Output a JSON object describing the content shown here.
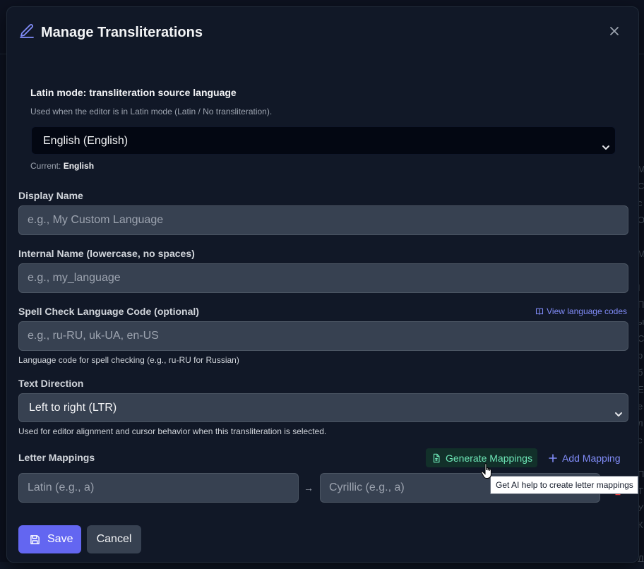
{
  "modal": {
    "title": "Manage Transliterations",
    "latin_mode": {
      "label": "Latin mode: transliteration source language",
      "help": "Used when the editor is in Latin mode (Latin / No transliteration).",
      "selected": "English (English)",
      "current_prefix": "Current: ",
      "current_value": "English"
    },
    "display_name": {
      "label": "Display Name",
      "placeholder": "e.g., My Custom Language"
    },
    "internal_name": {
      "label": "Internal Name (lowercase, no spaces)",
      "placeholder": "e.g., my_language"
    },
    "spell_check": {
      "label": "Spell Check Language Code (optional)",
      "link": "View language codes",
      "placeholder": "e.g., ru-RU, uk-UA, en-US",
      "help": "Language code for spell checking (e.g., ru-RU for Russian)"
    },
    "text_direction": {
      "label": "Text Direction",
      "selected": "Left to right (LTR)",
      "help": "Used for editor alignment and cursor behavior when this transliteration is selected."
    },
    "letter_mappings": {
      "label": "Letter Mappings",
      "generate_label": "Generate Mappings",
      "add_label": "Add Mapping",
      "latin_placeholder": "Latin (e.g., a)",
      "cyrillic_placeholder": "Cyrillic (e.g., a)",
      "arrow": "→",
      "tooltip": "Get AI help to create letter mappings"
    },
    "save_label": "Save",
    "cancel_label": "Cancel"
  },
  "colors": {
    "accent": "#6366f1",
    "link": "#818cf8",
    "generate": "#6ee7b7",
    "danger": "#ef4444"
  },
  "background": {
    "side_letters": [
      "М",
      "С",
      "с",
      "О",
      "і",
      "М",
      "",
      "І",
      "П",
      "ы",
      "С",
      "р",
      "б",
      "Е",
      "е",
      "л",
      "с",
      "",
      "П",
      "Т",
      "У",
      "К",
      "",
      "Д"
    ]
  }
}
